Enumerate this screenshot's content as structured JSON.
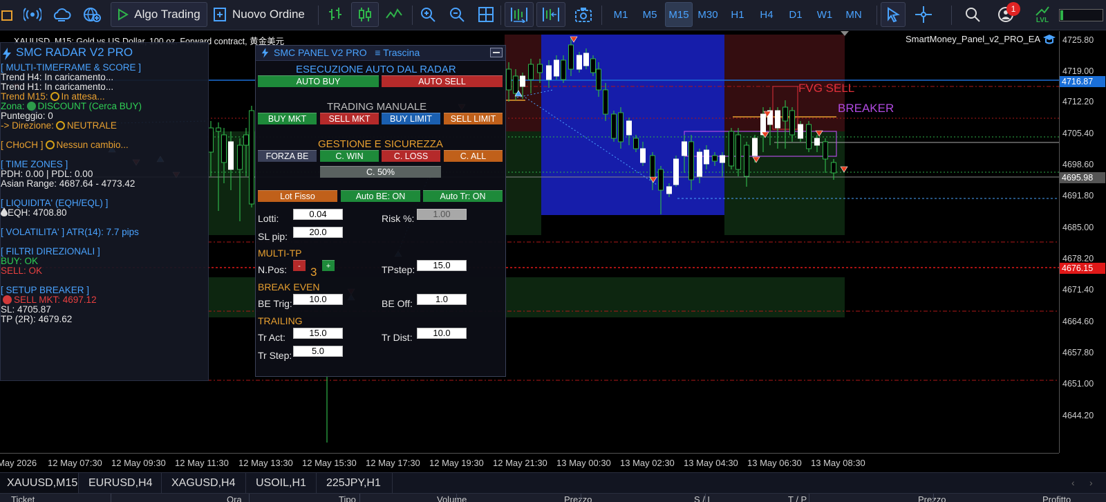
{
  "toolbar": {
    "algo_trading_label": "Algo Trading",
    "new_order_label": "Nuovo Ordine",
    "timeframes": [
      "M1",
      "M5",
      "M15",
      "M30",
      "H1",
      "H4",
      "D1",
      "W1",
      "MN"
    ],
    "active_timeframe": "M15",
    "notification_count": "1",
    "lvl_label": "LVL"
  },
  "chart": {
    "symbol_title": "XAUUSD, M15:  Gold vs US Dollar, 100 oz. Forward contract, 黄金美元",
    "ea_name": "SmartMoney_Panel_v2_PRO_EA",
    "price_labels": [
      "4725.80",
      "4719.00",
      "4712.20",
      "4705.40",
      "4698.60",
      "4691.80",
      "4685.00",
      "4678.20",
      "4671.40",
      "4664.60",
      "4657.80",
      "4651.00",
      "4644.20"
    ],
    "tag_blue": "4716.87",
    "tag_gray": "4695.98",
    "tag_red": "4676.15",
    "time_labels": [
      "May 2026",
      "12 May 07:30",
      "12 May 09:30",
      "12 May 11:30",
      "12 May 13:30",
      "12 May 15:30",
      "12 May 17:30",
      "12 May 19:30",
      "12 May 21:30",
      "13 May 00:30",
      "13 May 02:30",
      "13 May 04:30",
      "13 May 06:30",
      "13 May 08:30"
    ],
    "fvg_sell_label": "FVG SELL",
    "breaker_label": "BREAKER"
  },
  "radar": {
    "title": "SMC RADAR V2 PRO",
    "mtf_header": "[ MULTI-TIMEFRAME & SCORE ]",
    "trend_h4": "Trend H4: In caricamento...",
    "trend_h1": "Trend H1: In caricamento...",
    "trend_m15_label": "Trend M15:",
    "trend_m15_value": "In attesa...",
    "zona_label": "Zona:",
    "zona_value": "DISCOUNT (Cerca BUY)",
    "punteggio": "Punteggio: 0",
    "direzione_label": "-> Direzione:",
    "direzione_value": "NEUTRALE",
    "choch_label": "[ CHoCH ]",
    "choch_value": "Nessun cambio...",
    "time_zones_header": "[ TIME ZONES ]",
    "pdh_pdl": "PDH: 0.00 | PDL: 0.00",
    "asian_range": "Asian Range: 4687.64 - 4773.42",
    "liquidity_header": "[ LIQUIDITA' (EQH/EQL) ]",
    "eqh": "EQH: 4708.80",
    "volatility": "[ VOLATILITA' ] ATR(14): 7.7 pips",
    "filters_header": "[ FILTRI DIREZIONALI ]",
    "buy_ok": "BUY: OK",
    "sell_ok": "SELL: OK",
    "setup_header": "[ SETUP BREAKER ]",
    "sell_mkt": "SELL MKT: 4697.12",
    "sl": "SL: 4705.87",
    "tp": "TP (2R): 4679.62"
  },
  "panel": {
    "title": "SMC PANEL V2 PRO",
    "drag_label": "≡ Trascina",
    "auto_header": "ESECUZIONE AUTO DAL RADAR",
    "auto_buy": "AUTO BUY",
    "auto_sell": "AUTO SELL",
    "manual_header": "TRADING MANUALE",
    "buy_mkt": "BUY MKT",
    "sell_mkt": "SELL MKT",
    "buy_limit": "BUY LIMIT",
    "sell_limit": "SELL LIMIT",
    "mgmt_header": "GESTIONE E SICUREZZA",
    "forza_be": "FORZA BE",
    "c_win": "C. WIN",
    "c_loss": "C. LOSS",
    "c_all": "C. ALL",
    "c_50": "C. 50%",
    "lot_fisso": "Lot Fisso",
    "auto_be": "Auto BE: ON",
    "auto_tr": "Auto Tr: ON",
    "lotti_label": "Lotti:",
    "lotti_value": "0.04",
    "risk_label": "Risk %:",
    "risk_value": "1.00",
    "sl_pip_label": "SL pip:",
    "sl_pip_value": "20.0",
    "multi_tp_header": "MULTI-TP",
    "npos_label": "N.Pos:",
    "npos_minus": "-",
    "npos_plus": "+",
    "npos_value": "3",
    "tpstep_label": "TPstep:",
    "tpstep_value": "15.0",
    "break_even_header": "BREAK EVEN",
    "be_trig_label": "BE Trig:",
    "be_trig_value": "10.0",
    "be_off_label": "BE Off:",
    "be_off_value": "1.0",
    "trailing_header": "TRAILING",
    "tr_act_label": "Tr Act:",
    "tr_act_value": "15.0",
    "tr_dist_label": "Tr Dist:",
    "tr_dist_value": "10.0",
    "tr_step_label": "Tr Step:",
    "tr_step_value": "5.0"
  },
  "symbol_tabs": [
    "XAUUSD,M15",
    "EURUSD,H4",
    "XAGUSD,H4",
    "USOIL,H1",
    "225JPY,H1"
  ],
  "bottom_columns": [
    "Ticket",
    "Ora",
    "Tipo",
    "Volume",
    "Prezzo",
    "S / L",
    "T / P",
    "Prezzo",
    "Profitto"
  ],
  "colors": {
    "accent_blue": "#4aa3ff",
    "buy_green": "#1e8a3a",
    "sell_red": "#b52a2a",
    "orange": "#c0601a",
    "fvg_red": "#e0303a",
    "breaker_purple": "#b04ae0",
    "ob_blue": "#1a22c8"
  }
}
